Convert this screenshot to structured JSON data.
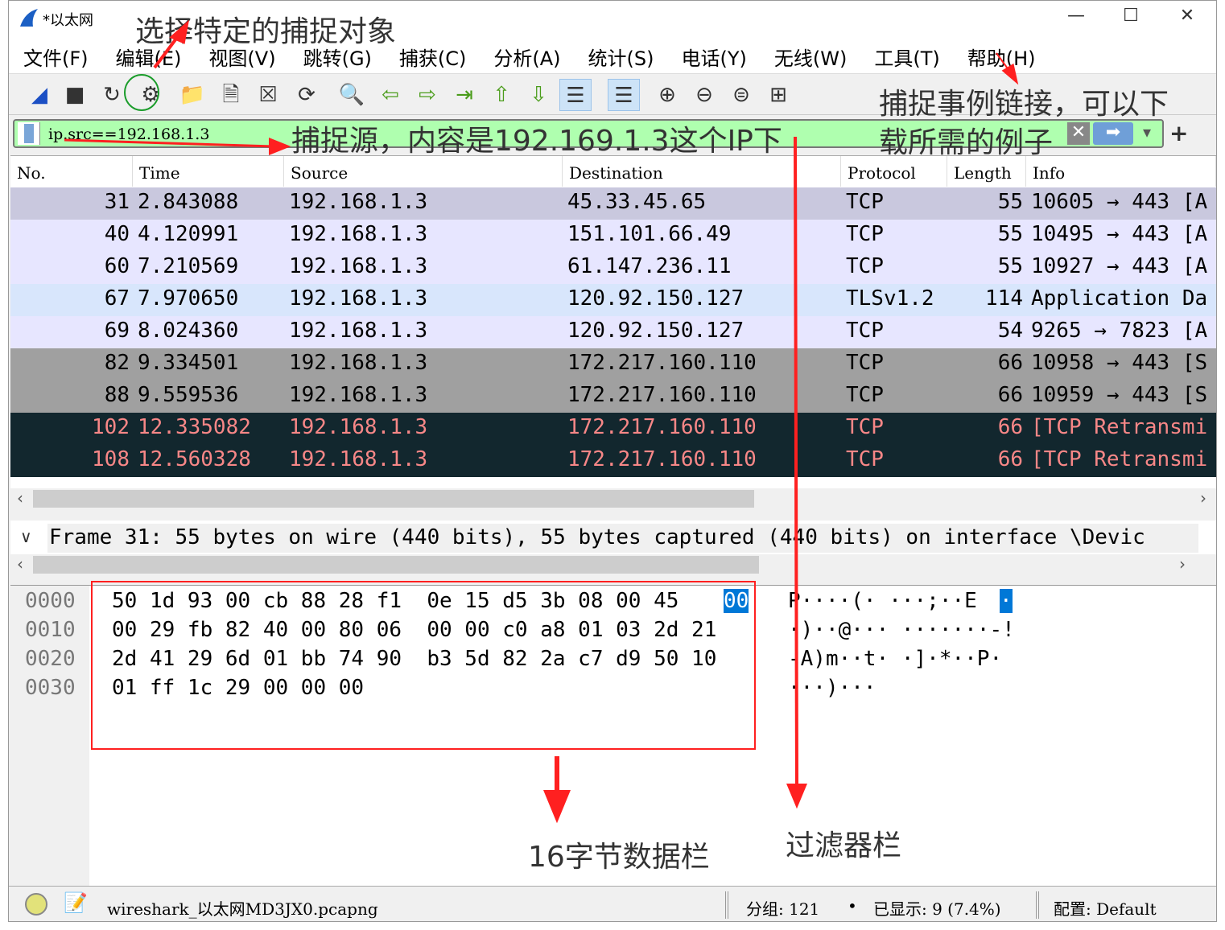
{
  "window": {
    "title": "*以太网",
    "minimize": "—",
    "maximize": "☐",
    "close": "✕"
  },
  "menu": [
    "文件(F)",
    "编辑(E)",
    "视图(V)",
    "跳转(G)",
    "捕获(C)",
    "分析(A)",
    "统计(S)",
    "电话(Y)",
    "无线(W)",
    "工具(T)",
    "帮助(H)"
  ],
  "toolbar": {
    "icons": [
      "shark-fin-start-icon",
      "stop-icon",
      "restart-icon",
      "capture-options-icon",
      "open-folder-icon",
      "open-file-icon",
      "close-file-icon",
      "reload-icon",
      "find-icon",
      "go-back-icon",
      "go-forward-icon",
      "go-to-packet-icon",
      "first-packet-icon",
      "last-packet-icon",
      "autoscroll-icon",
      "colorize-icon",
      "zoom-in-icon",
      "zoom-out-icon",
      "zoom-normal-icon",
      "resize-columns-icon"
    ]
  },
  "filter": {
    "value": "ip.src==192.168.1.3",
    "clear": "✕",
    "apply": "➡",
    "dropdown": "▾",
    "add": "+"
  },
  "packets": {
    "columns": [
      "No.",
      "Time",
      "Source",
      "Destination",
      "Protocol",
      "Length",
      "Info"
    ],
    "rows": [
      {
        "no": "31",
        "time": "2.843088",
        "src": "192.168.1.3",
        "dst": "45.33.45.65",
        "proto": "TCP",
        "len": "55",
        "info": "10605 → 443 [A",
        "bg": "#c9c8de",
        "fg": "#000000"
      },
      {
        "no": "40",
        "time": "4.120991",
        "src": "192.168.1.3",
        "dst": "151.101.66.49",
        "proto": "TCP",
        "len": "55",
        "info": "10495 → 443 [A",
        "bg": "#e7e6ff",
        "fg": "#000000"
      },
      {
        "no": "60",
        "time": "7.210569",
        "src": "192.168.1.3",
        "dst": "61.147.236.11",
        "proto": "TCP",
        "len": "55",
        "info": "10927 → 443 [A",
        "bg": "#e7e6ff",
        "fg": "#000000"
      },
      {
        "no": "67",
        "time": "7.970650",
        "src": "192.168.1.3",
        "dst": "120.92.150.127",
        "proto": "TLSv1.2",
        "len": "114",
        "info": "Application Da",
        "bg": "#d8e6fc",
        "fg": "#000000"
      },
      {
        "no": "69",
        "time": "8.024360",
        "src": "192.168.1.3",
        "dst": "120.92.150.127",
        "proto": "TCP",
        "len": "54",
        "info": "9265 → 7823 [A",
        "bg": "#e7e6ff",
        "fg": "#000000"
      },
      {
        "no": "82",
        "time": "9.334501",
        "src": "192.168.1.3",
        "dst": "172.217.160.110",
        "proto": "TCP",
        "len": "66",
        "info": "10958 → 443 [S",
        "bg": "#a0a0a0",
        "fg": "#000000"
      },
      {
        "no": "88",
        "time": "9.559536",
        "src": "192.168.1.3",
        "dst": "172.217.160.110",
        "proto": "TCP",
        "len": "66",
        "info": "10959 → 443 [S",
        "bg": "#a0a0a0",
        "fg": "#000000"
      },
      {
        "no": "102",
        "time": "12.335082",
        "src": "192.168.1.3",
        "dst": "172.217.160.110",
        "proto": "TCP",
        "len": "66",
        "info": "[TCP Retransmi",
        "bg": "#12272e",
        "fg": "#f78787"
      },
      {
        "no": "108",
        "time": "12.560328",
        "src": "192.168.1.3",
        "dst": "172.217.160.110",
        "proto": "TCP",
        "len": "66",
        "info": "[TCP Retransmi",
        "bg": "#12272e",
        "fg": "#f78787"
      }
    ]
  },
  "detail": {
    "expander": "∨",
    "text": "Frame 31: 55 bytes on wire (440 bits), 55 bytes captured (440 bits) on interface \\Devic"
  },
  "hex": {
    "offsets": [
      "0000",
      "0010",
      "0020",
      "0030"
    ],
    "lines": [
      "50 1d 93 00 cb 88 28 f1  0e 15 d5 3b 08 00 45 ",
      "00 29 fb 82 40 00 80 06  00 00 c0 a8 01 03 2d 21",
      "2d 41 29 6d 01 bb 74 90  b3 5d 82 2a c7 d9 50 10",
      "01 ff 1c 29 00 00 00"
    ],
    "selected_byte": "00",
    "ascii": [
      "P····(· ···;··E",
      "·)··@··· ·······-!",
      "-A)m··t· ·]·*··P·",
      "···)···"
    ],
    "selected_ascii": "·"
  },
  "status": {
    "file": "wireshark_以太网MD3JX0.pcapng",
    "packets": "分组: 121",
    "sep": "•",
    "displayed": "已显示: 9 (7.4%)",
    "profile": "配置: Default"
  },
  "annotations": {
    "select_target": "选择特定的捕捉对象",
    "capture_links_1": "捕捉事例链接，可以下",
    "capture_links_2": "载所需的例子",
    "source": "捕捉源，内容是192.169.1.3这个IP下",
    "hex_pane": "16字节数据栏",
    "filter_bar": "过滤器栏"
  },
  "colors": {
    "accent": "#0078d7",
    "annotation": "#ff2020",
    "filter_bg": "#afffaf"
  }
}
